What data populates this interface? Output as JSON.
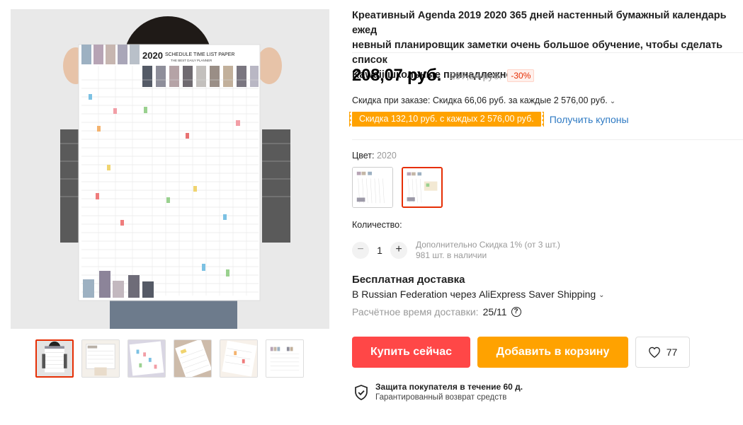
{
  "product": {
    "title": "Креативный Agenda 2019 2020 365 дней настенный бумажный календарь ежед\nневный планировщик заметки очень большое обучение, чтобы сделать список\nKawaii школьные принадлежности",
    "price": "208,07 руб.",
    "old_price": "297,24 руб.",
    "discount": "-30%",
    "store_discount": "Скидка при заказе: Скидка 66,06 руб. за каждые 2 576,00 руб.",
    "coupon": "Скидка 132,10 руб. с каждых 2 576,00 руб.",
    "coupon_link": "Получить купоны"
  },
  "color": {
    "label": "Цвет:",
    "value": "2020"
  },
  "quantity": {
    "label": "Количество:",
    "minus": "−",
    "plus": "+",
    "value": "1",
    "bulk_discount": "Дополнительно Скидка 1% (от 3 шт.)",
    "stock": "981 шт. в наличии"
  },
  "shipping": {
    "title": "Бесплатная доставка",
    "via": "В Russian Federation через AliExpress Saver Shipping",
    "eta_label": "Расчётное время доставки:",
    "eta_date": "25/11",
    "help": "?"
  },
  "actions": {
    "buy": "Купить сейчас",
    "cart": "Добавить в корзину",
    "wishlist_count": "77"
  },
  "protection": {
    "title": "Защита покупателя в течение 60 д.",
    "subtitle": "Гарантированный возврат средств"
  },
  "poster": {
    "year": "2020",
    "headline": "SCHEDULE TIME LIST PAPER",
    "tagline": "THE BEST DAILY PLANNER"
  },
  "colors": {
    "price_red": "#e62e04",
    "buy_red": "#ff4747",
    "cart_orange": "#ffa200",
    "link_blue": "#2e7ac3"
  }
}
